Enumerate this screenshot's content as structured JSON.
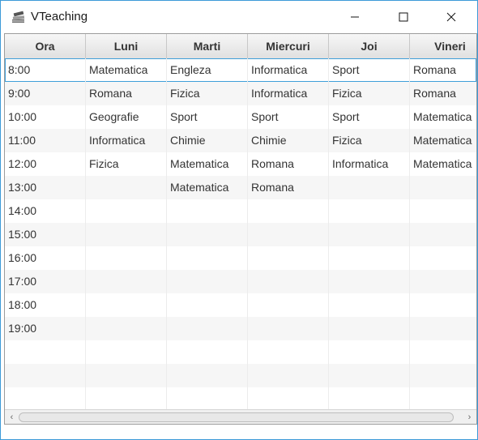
{
  "window": {
    "title": "VTeaching",
    "app_icon": "books-icon"
  },
  "table": {
    "columns": [
      "Ora",
      "Luni",
      "Marti",
      "Miercuri",
      "Joi",
      "Vineri"
    ],
    "rows": [
      [
        "8:00",
        "Matematica",
        "Engleza",
        "Informatica",
        "Sport",
        "Romana"
      ],
      [
        "9:00",
        "Romana",
        "Fizica",
        "Informatica",
        "Fizica",
        "Romana"
      ],
      [
        "10:00",
        "Geografie",
        "Sport",
        "Sport",
        "Sport",
        "Matematica"
      ],
      [
        "11:00",
        "Informatica",
        "Chimie",
        "Chimie",
        "Fizica",
        "Matematica"
      ],
      [
        "12:00",
        "Fizica",
        "Matematica",
        "Romana",
        "Informatica",
        "Matematica"
      ],
      [
        "13:00",
        "",
        "Matematica",
        "Romana",
        "",
        ""
      ],
      [
        "14:00",
        "",
        "",
        "",
        "",
        ""
      ],
      [
        "15:00",
        "",
        "",
        "",
        "",
        ""
      ],
      [
        "16:00",
        "",
        "",
        "",
        "",
        ""
      ],
      [
        "17:00",
        "",
        "",
        "",
        "",
        ""
      ],
      [
        "18:00",
        "",
        "",
        "",
        "",
        ""
      ],
      [
        "19:00",
        "",
        "",
        "",
        "",
        ""
      ],
      [
        "",
        "",
        "",
        "",
        "",
        ""
      ],
      [
        "",
        "",
        "",
        "",
        "",
        ""
      ],
      [
        "",
        "",
        "",
        "",
        "",
        ""
      ],
      [
        "",
        "",
        "",
        "",
        "",
        ""
      ]
    ],
    "selected_row": 0
  },
  "colors": {
    "accent": "#3c9ad8",
    "row_alt": "#f6f6f6"
  }
}
